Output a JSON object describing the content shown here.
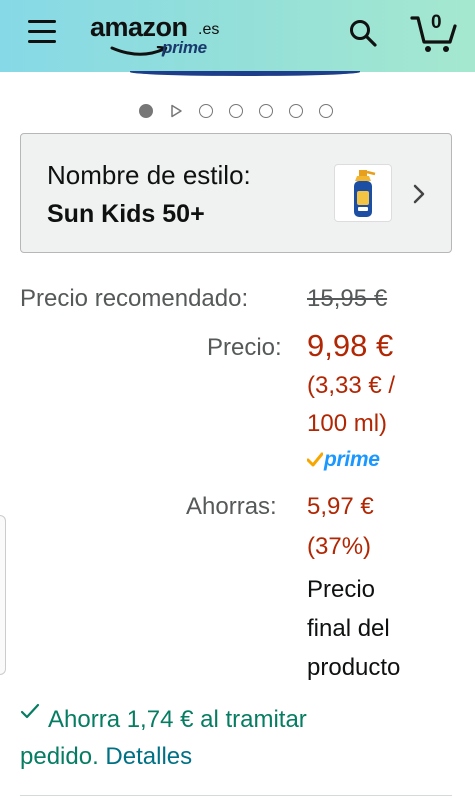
{
  "header": {
    "logo_word": "amazon",
    "logo_tld": ".es",
    "logo_sub": "prime",
    "cart_count": "0",
    "icons": [
      "hamburger-menu-icon",
      "search-icon",
      "cart-icon"
    ]
  },
  "carousel": {
    "total_indicators": 7,
    "active_index": 0,
    "video_indicator_index": 1
  },
  "style_selector": {
    "label": "Nombre de estilo:",
    "value": "Sun Kids 50+",
    "thumbnail_icon": "sunscreen-spray-bottle-icon"
  },
  "pricing": {
    "recommended_label": "Precio recomendado:",
    "recommended_value": "15,95 €",
    "price_label": "Precio:",
    "price_value": "9,98 €",
    "unit_price_line1": "(3,33 € /",
    "unit_price_line2": "100 ml)",
    "prime_badge": "prime",
    "savings_label": "Ahorras:",
    "savings_value": "5,97 €",
    "savings_percent": "(37%)",
    "final_line1": "Precio",
    "final_line2": "final del",
    "final_line3": "producto"
  },
  "promo": {
    "line1": "Ahorra 1,74 € al tramitar",
    "line2_prefix": "pedido.",
    "details_link": "Detalles"
  },
  "colors": {
    "header_start": "#86d9e6",
    "header_end": "#a5e8cf",
    "price_red": "#b12704",
    "promo_green": "#067d62",
    "link_teal": "#007185",
    "prime_blue": "#1a98ff"
  }
}
